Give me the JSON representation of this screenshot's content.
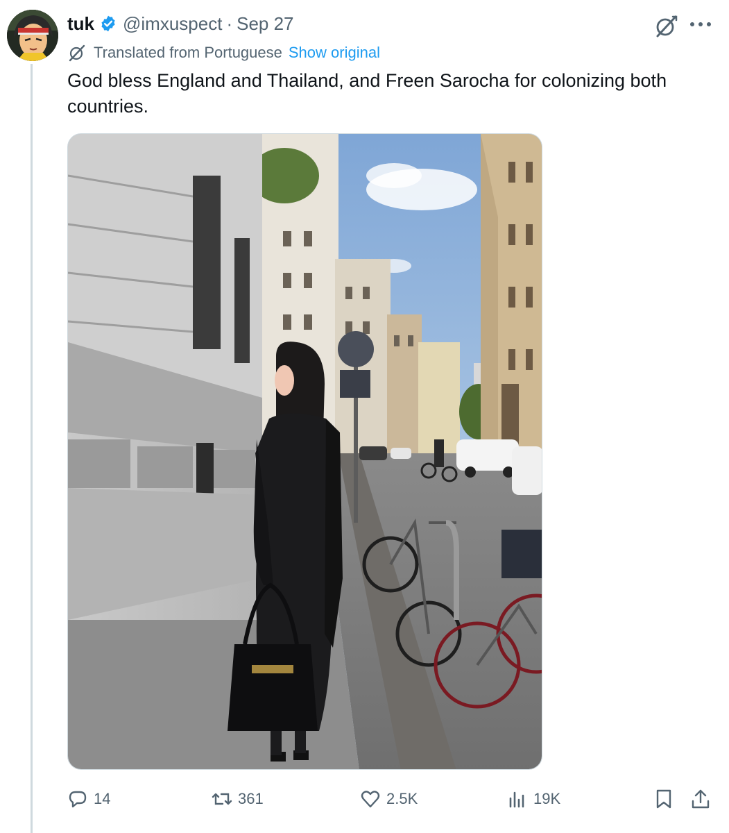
{
  "author": {
    "name": "tuk",
    "handle": "@imxuspect",
    "separator": "·",
    "date": "Sep 27",
    "verified": true
  },
  "translation": {
    "label": "Translated from Portuguese",
    "show_original": "Show original"
  },
  "tweet_text": "God bless England and Thailand, and Freen Sarocha for colonizing both countries.",
  "media": {
    "description_kind": "photo"
  },
  "actions": {
    "replies": "14",
    "reposts": "361",
    "likes": "2.5K",
    "views": "19K"
  },
  "icons": {
    "verified": "verified-badge-icon",
    "grok": "grok-icon",
    "more": "more-icon",
    "translate": "translate-icon",
    "reply": "reply-icon",
    "repost": "repost-icon",
    "like": "heart-icon",
    "views": "views-icon",
    "bookmark": "bookmark-icon",
    "share": "share-icon"
  },
  "colors": {
    "accent": "#1d9bf0",
    "secondary_text": "#536471",
    "primary_text": "#0f1419"
  }
}
